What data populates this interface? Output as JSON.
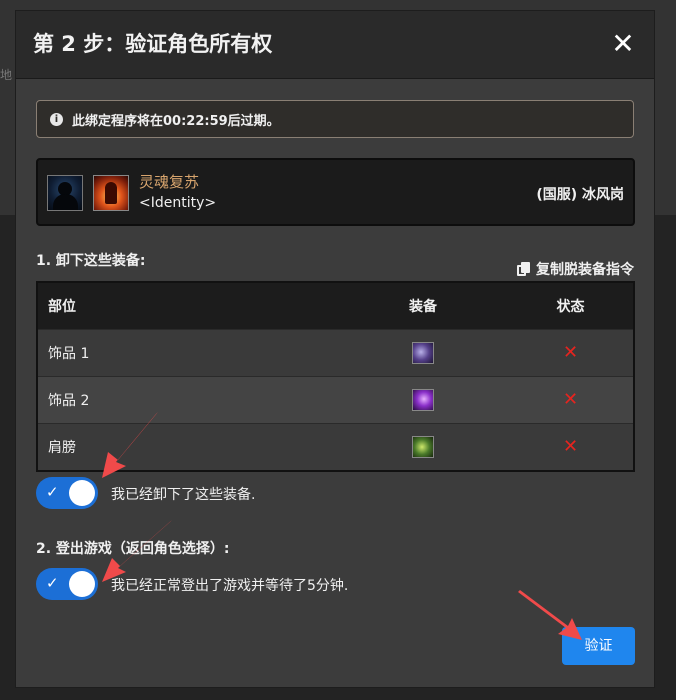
{
  "background": {
    "partial_text": "地"
  },
  "modal": {
    "title": "第 2 步：验证角色所有权",
    "close_label": "✕",
    "alert_text": "此绑定程序将在00:22:59后过期。",
    "character": {
      "name": "灵魂复苏",
      "title": "<Identity>",
      "realm": "(国服) 冰风岗"
    },
    "step1": {
      "heading": "1. 卸下这些装备:",
      "copy_label": "复制脱装备指令",
      "table": {
        "headers": [
          "部位",
          "装备",
          "状态"
        ],
        "rows": [
          {
            "slot": "饰品 1",
            "item_icon": "trinket-1-icon",
            "status": "✕"
          },
          {
            "slot": "饰品 2",
            "item_icon": "trinket-2-icon",
            "status": "✕"
          },
          {
            "slot": "肩膀",
            "item_icon": "shoulder-icon",
            "status": "✕"
          }
        ]
      },
      "toggle_label": "我已经卸下了这些装备.",
      "toggle_on": true
    },
    "step2": {
      "heading": "2. 登出游戏（返回角色选择）:",
      "toggle_label": "我已经正常登出了游戏并等待了5分钟.",
      "toggle_on": true
    },
    "verify_label": "验证"
  },
  "colors": {
    "accent": "#1f86ee",
    "toggle": "#1c6fd6",
    "error": "#e6241f",
    "character_name": "#d7a46d",
    "annotation_arrow": "#f04a4a"
  }
}
